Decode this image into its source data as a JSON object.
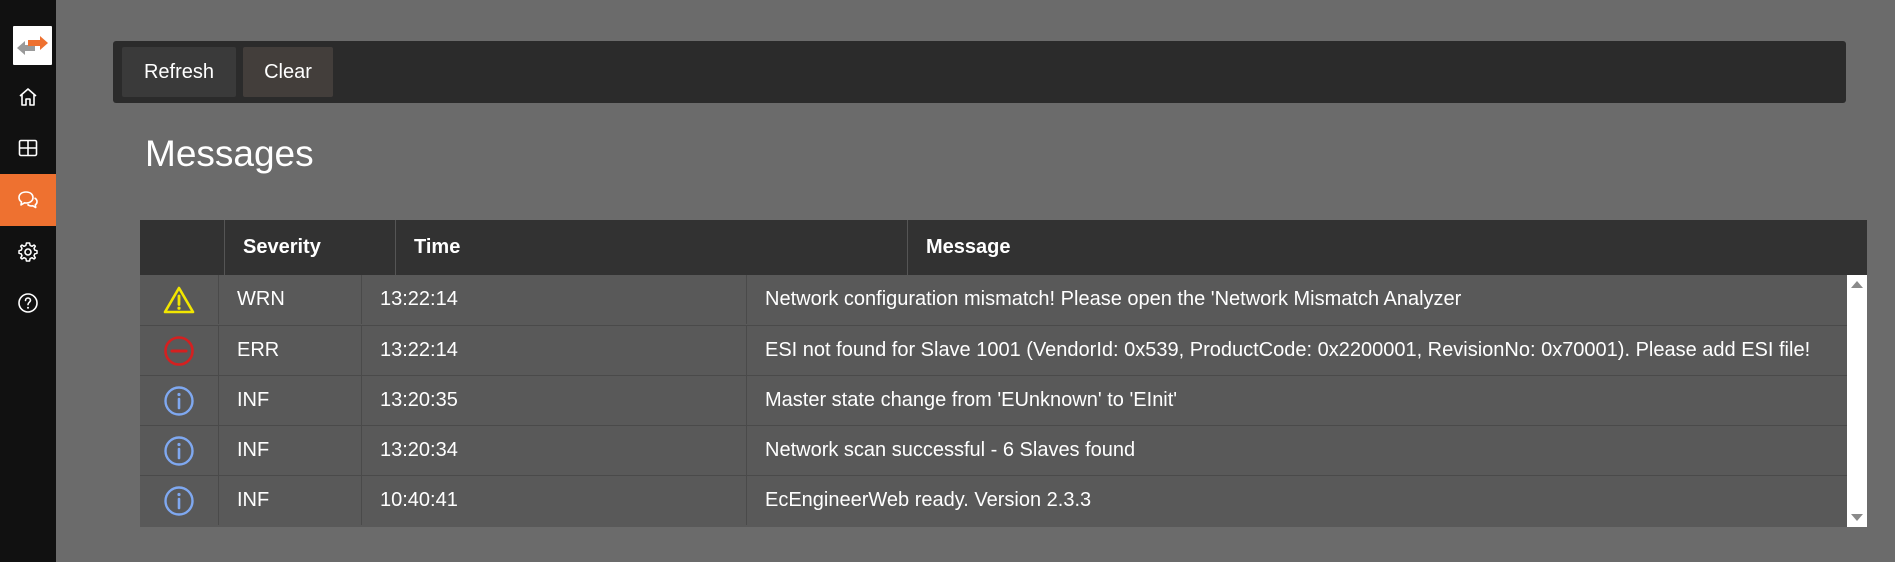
{
  "sidebar": {
    "logo": "ecengineer-logo",
    "items": [
      {
        "icon": "home-icon",
        "active": false
      },
      {
        "icon": "grid-icon",
        "active": false
      },
      {
        "icon": "messages-icon",
        "active": true
      },
      {
        "icon": "gear-icon",
        "active": false
      },
      {
        "icon": "help-icon",
        "active": false
      }
    ]
  },
  "toolbar": {
    "refresh_label": "Refresh",
    "clear_label": "Clear"
  },
  "page": {
    "title": "Messages"
  },
  "table": {
    "headers": {
      "icon": "",
      "severity": "Severity",
      "time": "Time",
      "message": "Message"
    },
    "rows": [
      {
        "icon": "warning-icon",
        "severity": "WRN",
        "time": "13:22:14",
        "message": "Network configuration mismatch! Please open the 'Network Mismatch Analyzer"
      },
      {
        "icon": "error-icon",
        "severity": "ERR",
        "time": "13:22:14",
        "message": "ESI not found for Slave 1001 (VendorId: 0x539, ProductCode: 0x2200001, RevisionNo: 0x70001). Please add ESI file!"
      },
      {
        "icon": "info-icon",
        "severity": "INF",
        "time": "13:20:35",
        "message": "Master state change from 'EUnknown' to 'EInit'"
      },
      {
        "icon": "info-icon",
        "severity": "INF",
        "time": "13:20:34",
        "message": "Network scan successful - 6 Slaves found"
      },
      {
        "icon": "info-icon",
        "severity": "INF",
        "time": "10:40:41",
        "message": "EcEngineerWeb ready. Version 2.3.3"
      }
    ]
  },
  "colors": {
    "accent": "#ee7130",
    "warning": "#f2e600",
    "error": "#d42020",
    "info": "#7fa8f0"
  }
}
